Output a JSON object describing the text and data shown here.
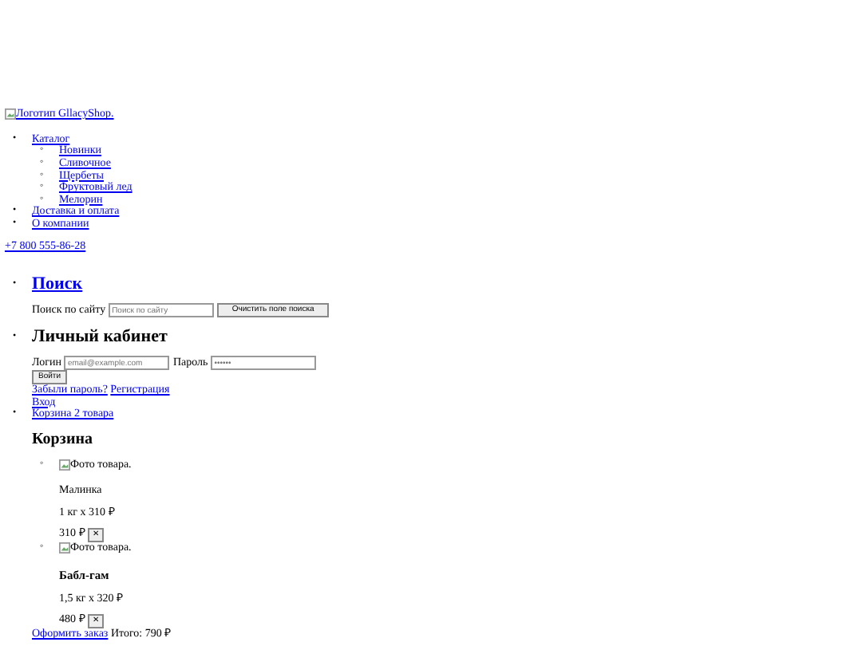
{
  "logo": {
    "alt": "Логотип GllacyShop."
  },
  "nav": [
    {
      "marker": "•",
      "label": "Каталог",
      "children": [
        {
          "marker": "◦",
          "label": "Новинки"
        },
        {
          "marker": "◦",
          "label": "Сливочное"
        },
        {
          "marker": "◦",
          "label": "Щербеты"
        },
        {
          "marker": "◦",
          "label": "Фруктовый лед"
        },
        {
          "marker": "◦",
          "label": "Мелорин"
        }
      ]
    },
    {
      "marker": "•",
      "label": "Доставка и оплата"
    },
    {
      "marker": "•",
      "label": "О компании"
    }
  ],
  "phone": "+7 800 555-86-28",
  "search": {
    "marker": "•",
    "heading": "Поиск",
    "label": "Поиск по сайту",
    "placeholder": "Поиск по сайту",
    "clear_button": "Очистить поле поиска"
  },
  "account": {
    "marker": "•",
    "heading": "Личный кабинет",
    "login_label": "Логин",
    "login_placeholder": "email@example.com",
    "password_label": "Пароль",
    "password_placeholder": "••••••",
    "submit": "Войти",
    "forgot_link": "Забыли пароль?",
    "register_link": "Регистрация",
    "signin_link": "Вход"
  },
  "cart": {
    "marker": "•",
    "link": "Корзина 2 товара",
    "heading": "Корзина",
    "items": [
      {
        "marker": "◦",
        "photo_alt": "Фото товара.",
        "name": "Малинка",
        "name_bold": false,
        "quantity": "1 кг х 310 ₽",
        "total": "310 ₽",
        "remove": "✕"
      },
      {
        "marker": "◦",
        "photo_alt": "Фото товара.",
        "name": "Бабл-гам",
        "name_bold": true,
        "quantity": "1,5 кг х 320 ₽",
        "total": "480 ₽",
        "remove": "✕"
      }
    ],
    "checkout_link": "Оформить заказ",
    "total": "Итого: 790 ₽"
  }
}
